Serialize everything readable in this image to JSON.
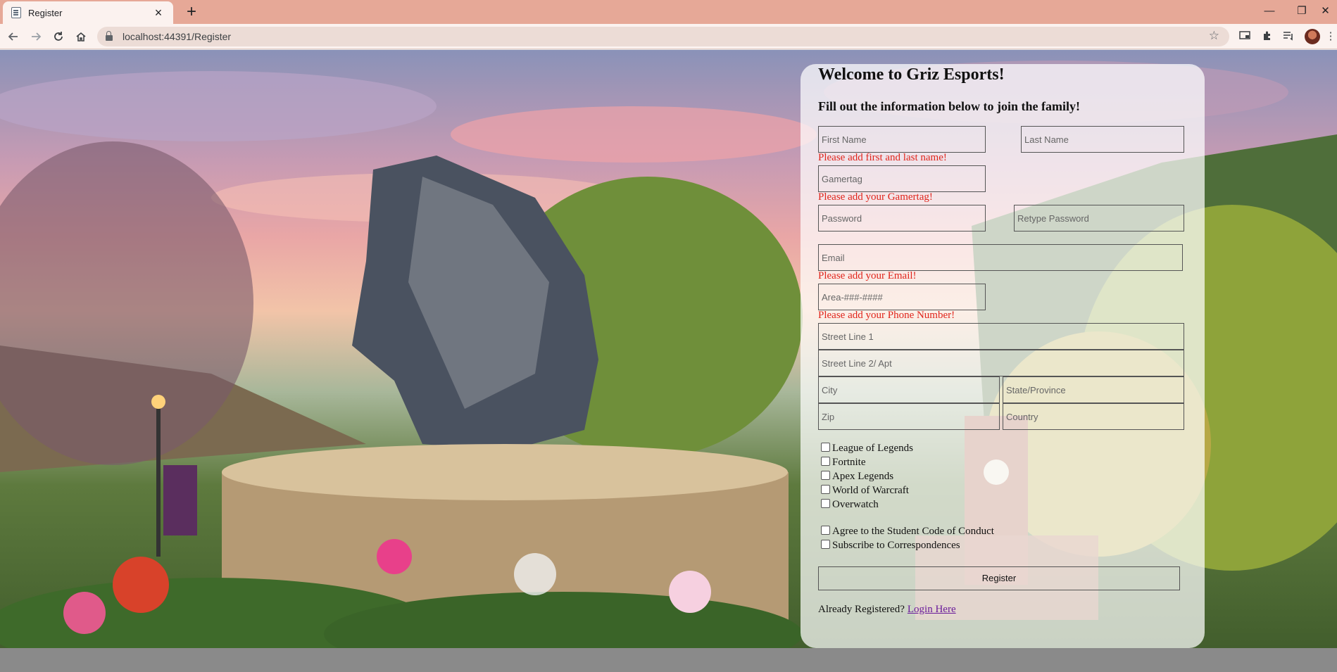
{
  "browser": {
    "tab_title": "Register",
    "tab_close": "×",
    "new_tab": "+",
    "url": "localhost:44391/Register",
    "window_controls": {
      "minimize": "—",
      "maximize": "❐",
      "close": "✕"
    }
  },
  "icons": {
    "back": "back-arrow-icon",
    "forward": "forward-arrow-icon",
    "reload": "reload-icon",
    "home": "home-icon",
    "bookmark": "star-icon",
    "extensions": "puzzle-icon"
  },
  "form": {
    "welcome": "Welcome to Griz Esports!",
    "subtitle": "Fill out the information below to join the family!",
    "placeholders": {
      "first_name": "First Name",
      "last_name": "Last Name",
      "gamertag": "Gamertag",
      "password": "Password",
      "retype_password": "Retype Password",
      "email": "Email",
      "phone": "Area-###-####",
      "street1": "Street Line 1",
      "street2": "Street Line 2/ Apt",
      "city": "City",
      "state": "State/Province",
      "zip": "Zip",
      "country": "Country"
    },
    "errors": {
      "name": "Please add first and last name!",
      "gamertag": "Please add your Gamertag!",
      "email": "Please add your Email!",
      "phone": "Please add your Phone Number!"
    },
    "games": [
      "League of Legends",
      "Fortnite",
      "Apex Legends",
      "World of Warcraft",
      "Overwatch"
    ],
    "agree_label": "Agree to the Student Code of Conduct",
    "subscribe_label": "Subscribe to Correspondences",
    "register_button": "Register",
    "already_text": "Already Registered?",
    "login_link": "Login Here"
  },
  "colors": {
    "tabstrip": "#e6a897",
    "error": "#e0241b",
    "link": "#6a1b9a"
  }
}
